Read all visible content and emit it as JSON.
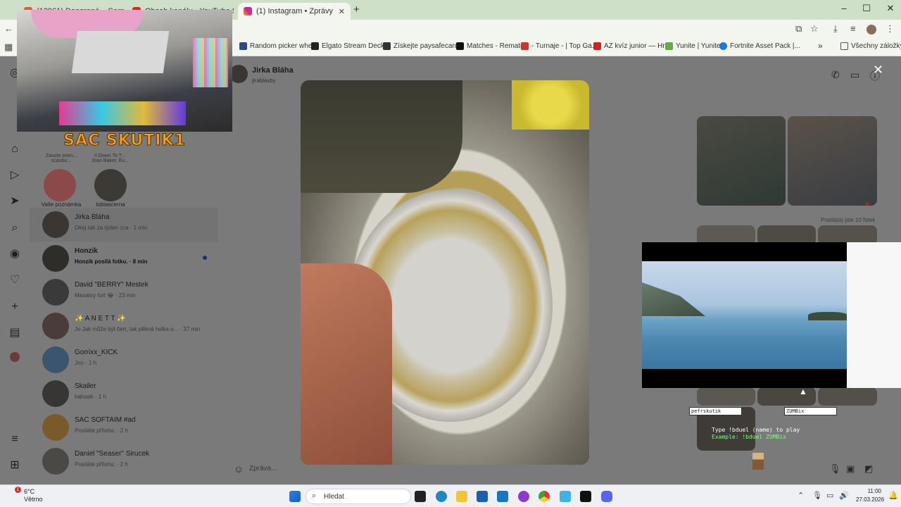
{
  "browser": {
    "tabs": [
      {
        "label": "(12961) Dongrané – Serpnam F...",
        "active": false
      },
      {
        "label": "Obsah kanálu - YouTube Studio",
        "active": false
      },
      {
        "label": "(1) Instagram • Zprávy",
        "active": true
      }
    ],
    "new_tab": "+",
    "window_controls": {
      "minimize": "–",
      "maximize": "☐",
      "close": "✕"
    },
    "bookmarks": [
      "Random picker whe...",
      "Elgato Stream Deck...",
      "Získejte paysafecard...",
      "Matches - Rematch",
      "- Turnaje - | Top Ga...",
      "AZ kvíz junior — Hr...",
      "Yunite | Yunite",
      "Fortnite Asset Pack |..."
    ],
    "bookmarks_more": "»",
    "all_bookmarks": "Všechny záložky"
  },
  "stream": {
    "streamer_name": "SAC SKUTIK1"
  },
  "instagram": {
    "notes": [
      {
        "top": "Zauste snen...",
        "sub": "scaubu...",
        "name": "Vaše poznámka"
      },
      {
        "top": "!! Down To T...",
        "sub": "Joan Baker, Ev...",
        "name": "tobiascerna"
      }
    ],
    "chats": [
      {
        "name": "Jirka Bláha",
        "preview": "Okej tak za týden cca · 1 min",
        "selected": true
      },
      {
        "name": "Honzik",
        "preview": "Honzik posílá fotku. · 8 min",
        "unread": true
      },
      {
        "name": "David \"BERRY\" Mestek",
        "preview": "Masakry furt 😂 · 23 min"
      },
      {
        "name": "✨ A N E T T ✨",
        "preview": "Jo Jak může být čert, tak pěkná holka o... · 37 min"
      },
      {
        "name": "Gorrixx_KICK",
        "preview": "Joo · 1 h"
      },
      {
        "name": "Skailer",
        "preview": "hahaah · 1 h"
      },
      {
        "name": "SAC SOFTAIM #ad",
        "preview": "Posíláte přílohu. · 2 h"
      },
      {
        "name": "Daniel \"Seaser\" Sirucek",
        "preview": "Posíláte přílohu. · 2 h"
      }
    ],
    "thread": {
      "name": "Jirka Bláha",
      "username": "jirablavby"
    },
    "sent_label": "Posílá(a) jste 10 fotek",
    "message_placeholder": "Zpráva...",
    "close": "✕"
  },
  "overlay": {
    "players": [
      "pefrskutik",
      "ZUMBix"
    ],
    "game_line1": "Type !bduel (name) to play",
    "game_line2": "Example: !bduel ZUMBix"
  },
  "taskbar": {
    "weather_temp": "6°C",
    "weather_desc": "Větrno",
    "weather_badge": "1",
    "search_label": "Hledat",
    "time": "11:00",
    "date": "27.03.2026"
  }
}
